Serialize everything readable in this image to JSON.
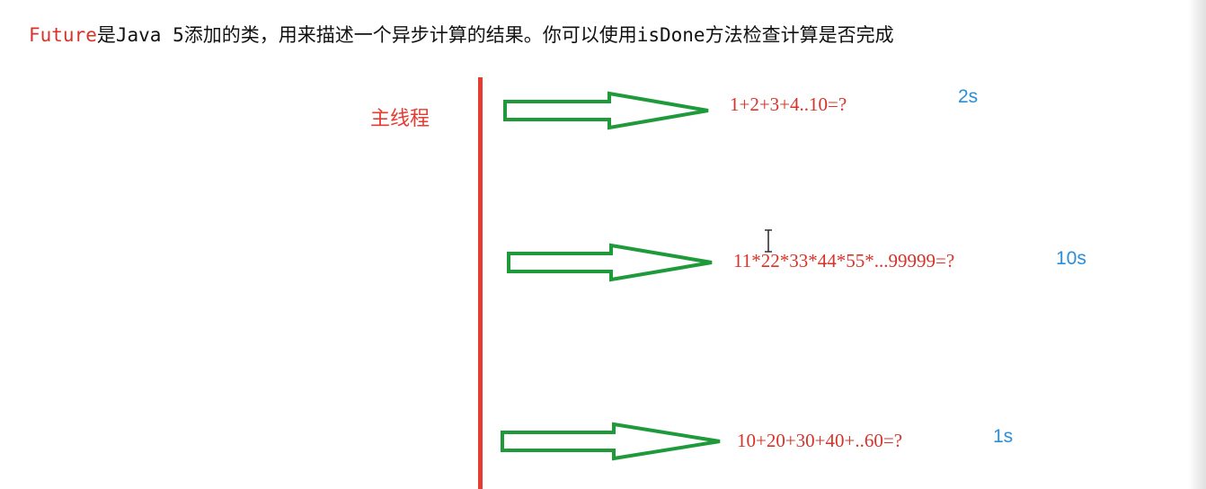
{
  "heading": {
    "keyword": "Future",
    "rest": "是Java 5添加的类，用来描述一个异步计算的结果。你可以使用isDone方法检查计算是否完成"
  },
  "main_thread": {
    "label": "主线程"
  },
  "tasks": [
    {
      "expression": "1+2+3+4..10=?",
      "duration": "2s"
    },
    {
      "expression": "11*22*33*44*55*...99999=?",
      "duration": "10s"
    },
    {
      "expression": "10+20+30+40+..60=?",
      "duration": "1s"
    }
  ],
  "colors": {
    "thread_line": "#e53b30",
    "arrow_stroke": "#1f9a3a",
    "task_text": "#d8332a",
    "duration_text": "#2a8ed8"
  },
  "icons": {
    "cursor": "text-cursor-icon"
  }
}
